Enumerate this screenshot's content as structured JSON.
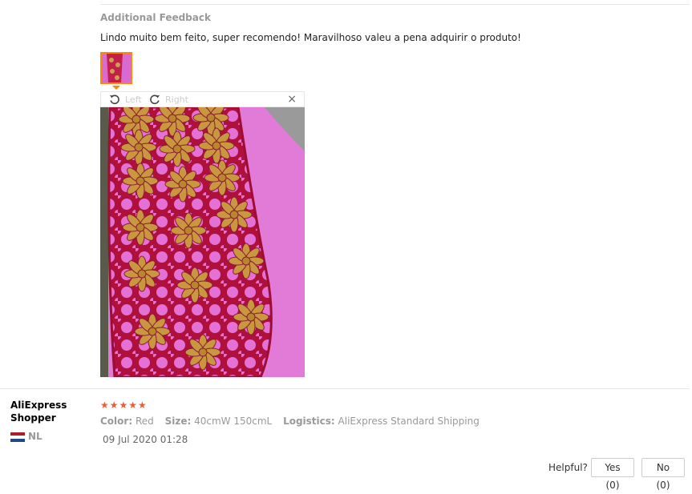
{
  "feedback": {
    "additional_title": "Additional Feedback",
    "text": "Lindo muito bem feito, super recomendo! Maravilhoso valeu a pena adquirir o produto!"
  },
  "viewer": {
    "rotate_left_label": "Left",
    "rotate_right_label": "Right",
    "close_glyph": "×",
    "icons": [
      "rotate-left-icon",
      "rotate-right-icon",
      "close-icon"
    ]
  },
  "reviewer": {
    "name": "AliExpress Shopper",
    "country": "NL"
  },
  "review": {
    "stars": "★★★★★",
    "rating": 5,
    "color_label": "Color:",
    "color_value": "Red",
    "size_label": "Size:",
    "size_value": "40cmW 150cmL",
    "logistics_label": "Logistics:",
    "logistics_value": "AliExpress Standard Shipping",
    "date": "09 Jul 2020 01:28"
  },
  "helpful": {
    "label": "Helpful?",
    "yes": "Yes (0)",
    "no": "No (0)"
  },
  "colors": {
    "accent": "#ff8800",
    "stars": "#f25a31",
    "muted_text": "#999999"
  }
}
